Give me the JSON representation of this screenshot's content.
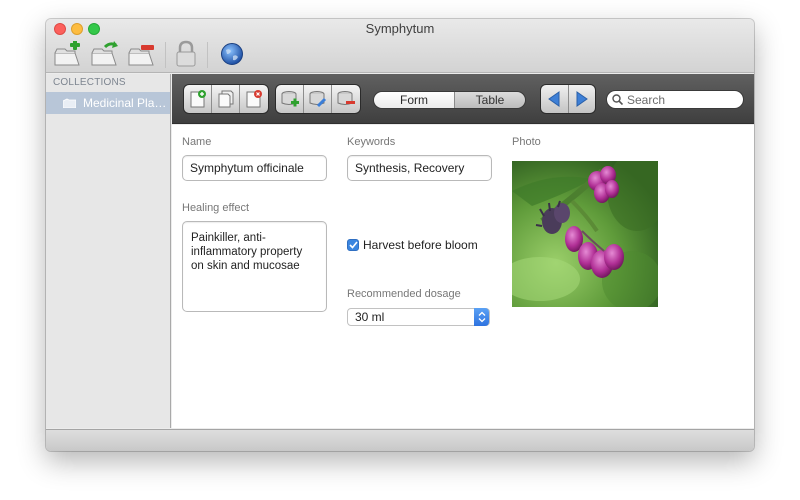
{
  "window": {
    "title": "Symphytum"
  },
  "toolbar": {
    "icons": [
      "add-collection-icon",
      "duplicate-collection-icon",
      "delete-collection-icon",
      "lock-icon",
      "globe-icon"
    ]
  },
  "sidebar": {
    "header": "COLLECTIONS",
    "items": [
      {
        "label": "Medicinal Plan...",
        "selected": true
      }
    ]
  },
  "record_toolbar": {
    "icons": [
      "new-record-icon",
      "duplicate-record-icon",
      "delete-record-icon",
      "add-field-icon",
      "modify-field-icon",
      "delete-field-icon",
      "previous-record-icon",
      "next-record-icon"
    ],
    "view_modes": {
      "form": "Form",
      "table": "Table",
      "selected": "Form"
    },
    "search_placeholder": "Search"
  },
  "form": {
    "name": {
      "label": "Name",
      "value": "Symphytum officinale"
    },
    "keywords": {
      "label": "Keywords",
      "value": "Synthesis, Recovery"
    },
    "photo": {
      "label": "Photo"
    },
    "healing_effect": {
      "label": "Healing effect",
      "value": "Painkiller, anti-\ninflammatory property\non skin and mucosae"
    },
    "harvest": {
      "label": "Harvest before bloom",
      "checked": true
    },
    "dosage": {
      "label": "Recommended dosage",
      "value": "30 ml"
    }
  },
  "colors": {
    "accent": "#3b86e0",
    "selection": "#b8c6d8",
    "toolbar_dark": "#4a4a4a"
  }
}
